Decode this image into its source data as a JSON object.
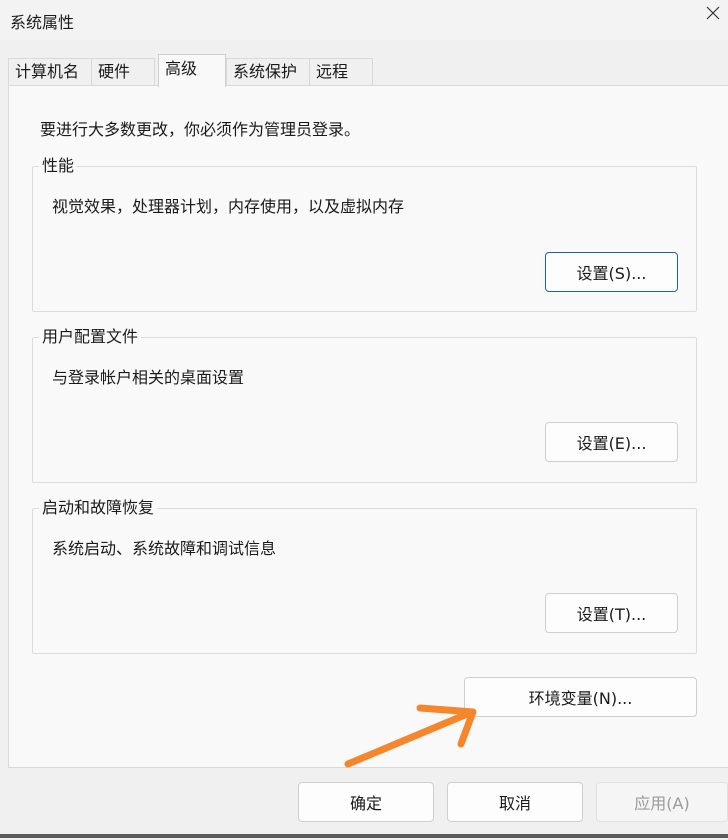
{
  "window": {
    "title": "系统属性"
  },
  "tabs": [
    {
      "label": "计算机名"
    },
    {
      "label": "硬件"
    },
    {
      "label": "高级"
    },
    {
      "label": "系统保护"
    },
    {
      "label": "远程"
    }
  ],
  "active_tab": "高级",
  "intro_text": "要进行大多数更改，你必须作为管理员登录。",
  "performance": {
    "title": "性能",
    "description": "视觉效果，处理器计划，内存使用，以及虚拟内存",
    "button": "设置(S)..."
  },
  "user_profiles": {
    "title": "用户配置文件",
    "description": "与登录帐户相关的桌面设置",
    "button": "设置(E)..."
  },
  "startup_recovery": {
    "title": "启动和故障恢复",
    "description": "系统启动、系统故障和调试信息",
    "button": "设置(T)..."
  },
  "env_button": "环境变量(N)...",
  "footer": {
    "ok": "确定",
    "cancel": "取消",
    "apply": "应用(A)"
  },
  "colors": {
    "accent_border": "#1f5fa8",
    "annotation_arrow": "#f5862b"
  },
  "icons": {
    "close": "close-icon"
  }
}
